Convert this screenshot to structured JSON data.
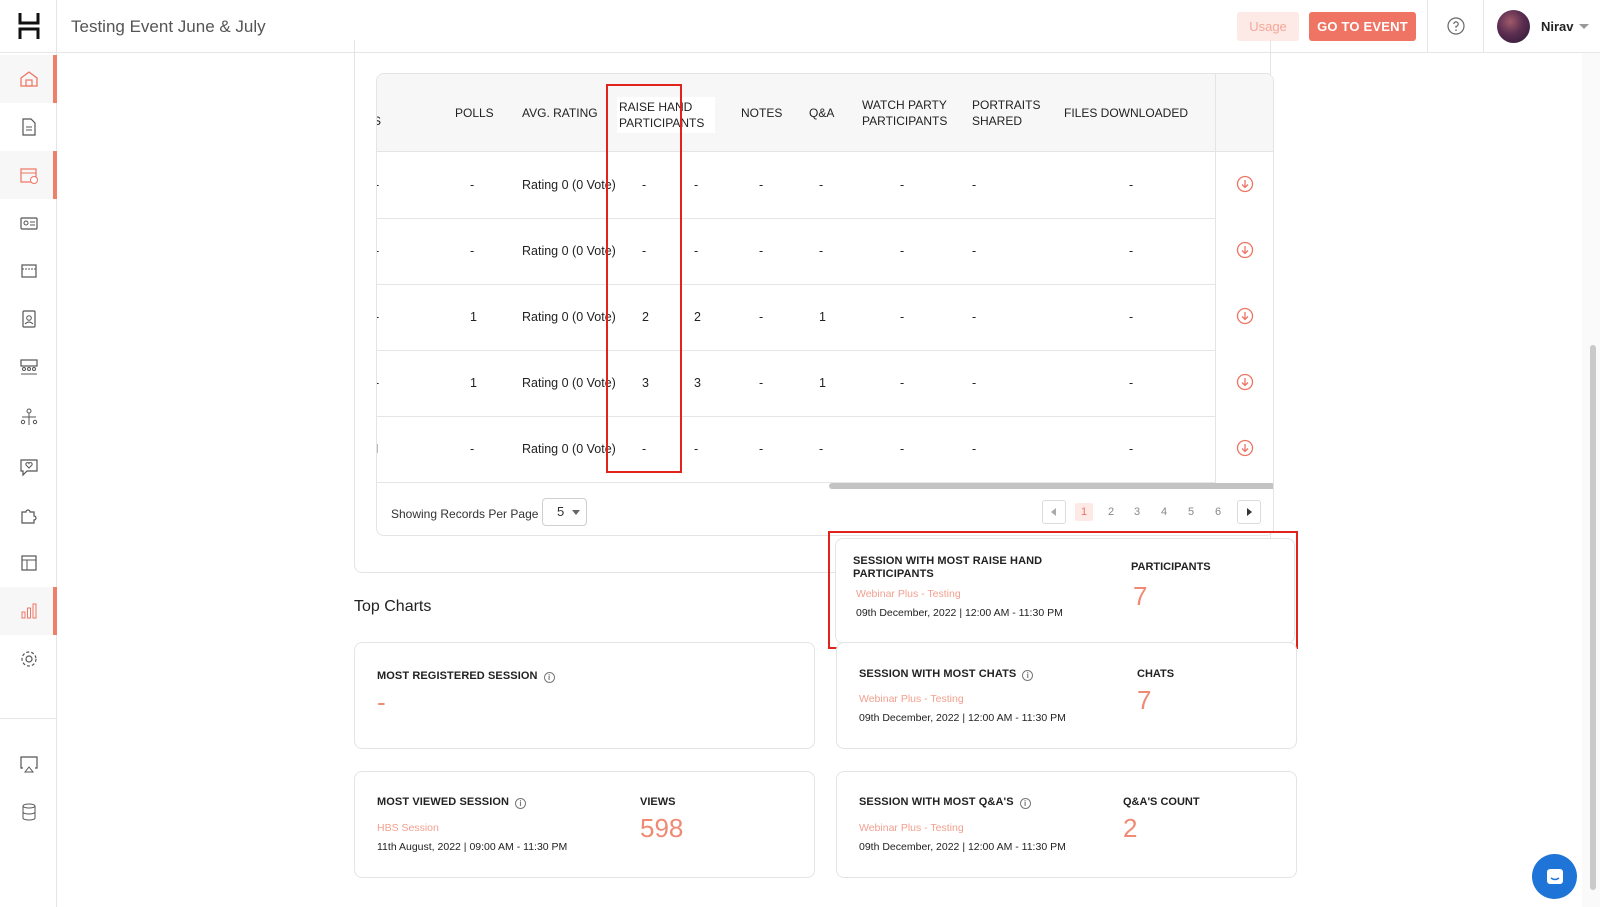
{
  "header": {
    "event_title": "Testing Event June & July",
    "usage_label": "Usage",
    "go_to_event_label": "GO TO EVENT",
    "user_name": "Nirav"
  },
  "sidebar": {
    "items": [
      {
        "name": "home",
        "active": true
      },
      {
        "name": "document",
        "active": false
      },
      {
        "name": "calendar",
        "active": true
      },
      {
        "name": "attendees",
        "active": false
      },
      {
        "name": "booth",
        "active": false
      },
      {
        "name": "speaker",
        "active": false
      },
      {
        "name": "lounge",
        "active": false
      },
      {
        "name": "networking",
        "active": false
      },
      {
        "name": "engagement",
        "active": false
      },
      {
        "name": "integrations",
        "active": false
      },
      {
        "name": "layout",
        "active": false
      },
      {
        "name": "analytics",
        "active": true
      },
      {
        "name": "settings",
        "active": false
      },
      {
        "name": "present",
        "active": false
      },
      {
        "name": "database",
        "active": false
      }
    ]
  },
  "table": {
    "headers": {
      "cut": "S",
      "polls": "POLLS",
      "avg_rating": "AVG. RATING",
      "raise_hand": "RAISE HAND PARTICIPANTS",
      "notes": "NOTES",
      "qa": "Q&A",
      "watch_party": "WATCH PARTY PARTICIPANTS",
      "portraits": "PORTRAITS SHARED",
      "files": "FILES DOWNLOADED"
    },
    "rows": [
      {
        "cut": "-",
        "polls": "-",
        "avg_rating": "Rating 0 (0 Vote)",
        "raise_hand": "-",
        "extra": "-",
        "notes": "-",
        "qa": "-",
        "watch_party": "-",
        "portraits": "-",
        "files": "-"
      },
      {
        "cut": "-",
        "polls": "-",
        "avg_rating": "Rating 0 (0 Vote)",
        "raise_hand": "-",
        "extra": "-",
        "notes": "-",
        "qa": "-",
        "watch_party": "-",
        "portraits": "-",
        "files": "-"
      },
      {
        "cut": "-",
        "polls": "1",
        "avg_rating": "Rating 0 (0 Vote)",
        "raise_hand": "2",
        "extra": "2",
        "notes": "-",
        "qa": "1",
        "watch_party": "-",
        "portraits": "-",
        "files": "-"
      },
      {
        "cut": "-",
        "polls": "1",
        "avg_rating": "Rating 0 (0 Vote)",
        "raise_hand": "3",
        "extra": "3",
        "notes": "-",
        "qa": "1",
        "watch_party": "-",
        "portraits": "-",
        "files": "-"
      },
      {
        "cut": "I",
        "polls": "-",
        "avg_rating": "Rating 0 (0 Vote)",
        "raise_hand": "-",
        "extra": "-",
        "notes": "-",
        "qa": "-",
        "watch_party": "-",
        "portraits": "-",
        "files": "-"
      }
    ],
    "per_page_label": "Showing Records Per Page",
    "per_page_value": "5",
    "pages": [
      "1",
      "2",
      "3",
      "4",
      "5",
      "6"
    ],
    "current_page": "1"
  },
  "top_charts": {
    "title": "Top Charts",
    "raise_hand_card": {
      "title": "SESSION WITH MOST RAISE HAND PARTICIPANTS",
      "session": "Webinar Plus - Testing",
      "date": "09th December, 2022 | 12:00 AM - 11:30 PM",
      "metric_label": "PARTICIPANTS",
      "metric_value": "7"
    },
    "registered_card": {
      "title": "MOST REGISTERED SESSION",
      "value": "-"
    },
    "chats_card": {
      "title": "SESSION WITH MOST CHATS",
      "session": "Webinar Plus - Testing",
      "date": "09th December, 2022 | 12:00 AM - 11:30 PM",
      "metric_label": "CHATS",
      "metric_value": "7"
    },
    "viewed_card": {
      "title": "MOST VIEWED SESSION",
      "session": "HBS Session",
      "date": "11th August, 2022 | 09:00 AM - 11:30 PM",
      "metric_label": "VIEWS",
      "metric_value": "598"
    },
    "qa_card": {
      "title": "SESSION WITH MOST Q&A'S",
      "session": "Webinar Plus - Testing",
      "date": "09th December, 2022 | 12:00 AM - 11:30 PM",
      "metric_label": "Q&A'S COUNT",
      "metric_value": "2"
    }
  },
  "colors": {
    "accent": "#ef7463",
    "accent_light": "#fde9e5",
    "highlight_border": "#e0241b",
    "chat_fab": "#1f74d8"
  }
}
